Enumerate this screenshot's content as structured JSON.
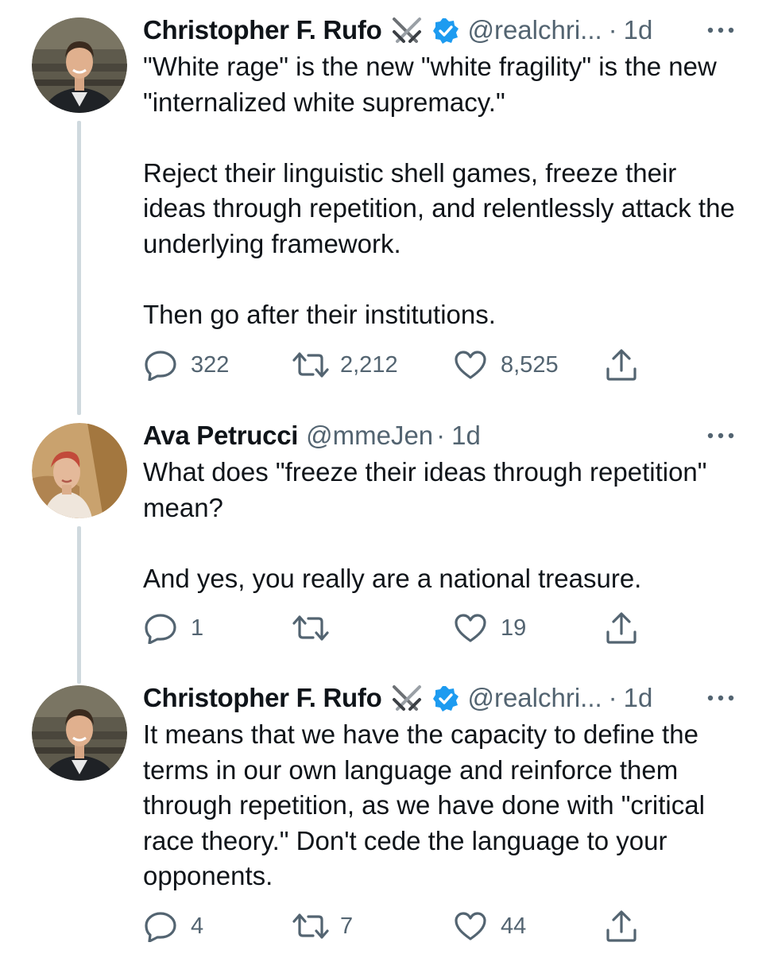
{
  "tweets": [
    {
      "name": "Christopher F. Rufo",
      "handle": "@realchri...",
      "dot": "·",
      "time": "1d",
      "paragraphs": [
        "\"White rage\" is the new \"white fragility\" is the new \"internalized white supremacy.\"",
        "Reject their linguistic shell games, freeze their ideas through repetition, and relentlessly attack the underlying framework.",
        "Then go after their institutions."
      ],
      "replies": "322",
      "retweets": "2,212",
      "likes": "8,525",
      "icons": [
        "swords-icon",
        "verified-badge-icon",
        "more-icon",
        "reply-icon",
        "retweet-icon",
        "like-icon",
        "share-icon"
      ]
    },
    {
      "name": "Ava Petrucci",
      "handle": "@mmeJen",
      "dot": "·",
      "time": "1d",
      "paragraphs": [
        "What does \"freeze their ideas through repetition\" mean?",
        "And yes, you really are a national treasure."
      ],
      "replies": "1",
      "retweets": "",
      "likes": "19",
      "icons": [
        "more-icon",
        "reply-icon",
        "retweet-icon",
        "like-icon",
        "share-icon"
      ]
    },
    {
      "name": "Christopher F. Rufo",
      "handle": "@realchri...",
      "dot": "·",
      "time": "1d",
      "paragraphs": [
        "It means that we have the capacity to define the terms in our own language and reinforce them through repetition, as we have done with \"critical race theory.\" Don't cede the language to your opponents."
      ],
      "replies": "4",
      "retweets": "7",
      "likes": "44",
      "icons": [
        "swords-icon",
        "verified-badge-icon",
        "more-icon",
        "reply-icon",
        "retweet-icon",
        "like-icon",
        "share-icon"
      ]
    }
  ],
  "colors": {
    "text": "#0f1419",
    "secondary": "#536471",
    "verified": "#1d9bf0",
    "thread_line": "#cfd9de"
  }
}
